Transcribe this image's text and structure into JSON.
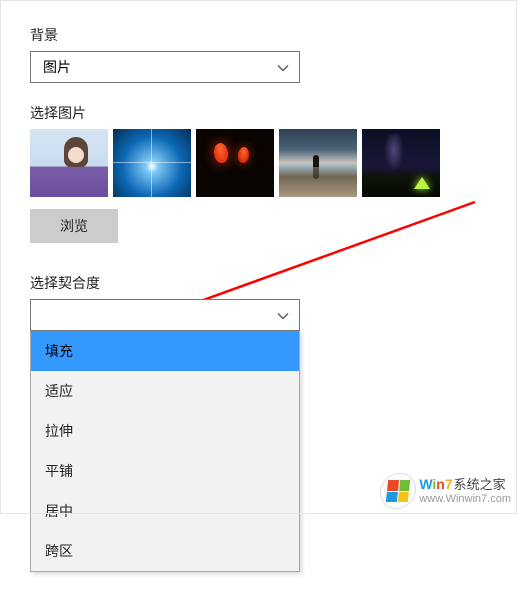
{
  "background": {
    "label": "背景",
    "selected": "图片"
  },
  "choose_picture": {
    "label": "选择图片",
    "thumbs": [
      {
        "name": "thumb-woman-lavender"
      },
      {
        "name": "thumb-windows-hero"
      },
      {
        "name": "thumb-tulips"
      },
      {
        "name": "thumb-beach"
      },
      {
        "name": "thumb-night-tent"
      }
    ],
    "browse_label": "浏览"
  },
  "fit": {
    "label": "选择契合度",
    "selected": "",
    "options": [
      "填充",
      "适应",
      "拉伸",
      "平铺",
      "居中",
      "跨区"
    ],
    "highlighted_index": 0
  },
  "watermark": {
    "brand_parts": {
      "w": "W",
      "i": "i",
      "n": "n",
      "seven": "7"
    },
    "brand_rest": "系统之家",
    "url": "www.Winwin7.com"
  }
}
